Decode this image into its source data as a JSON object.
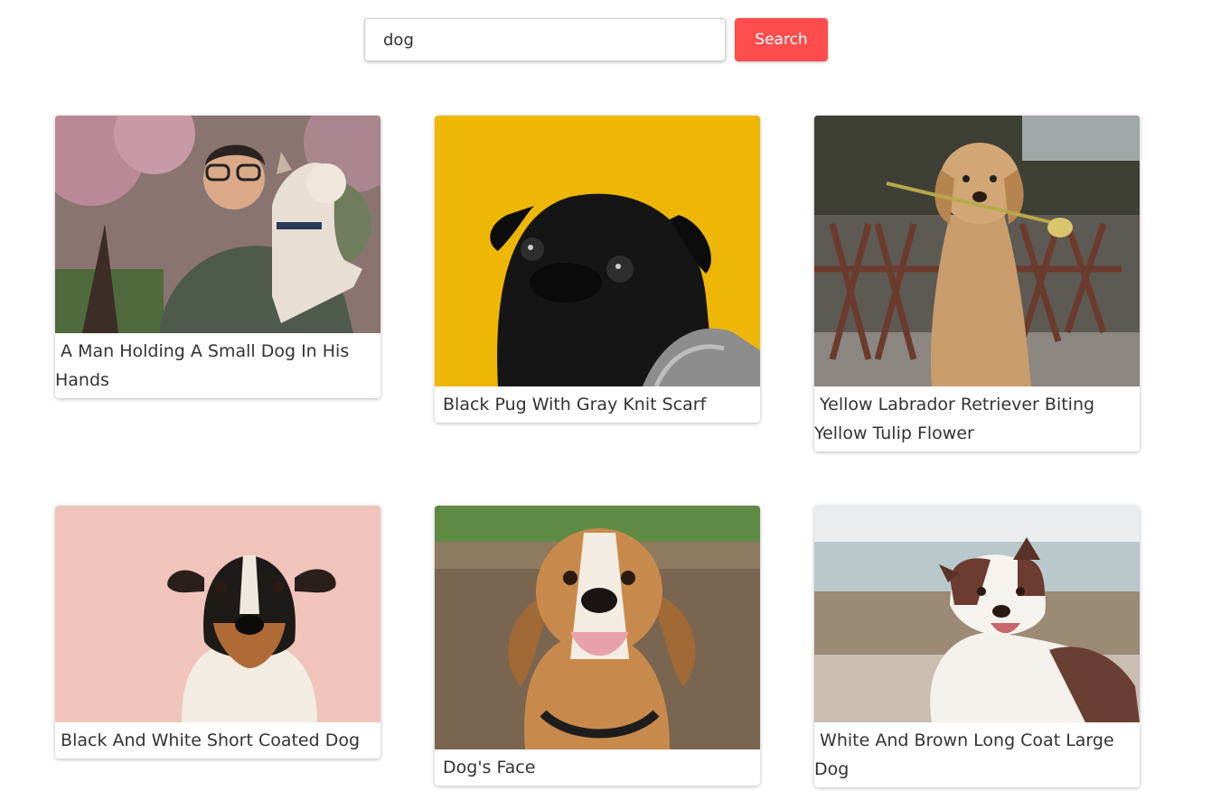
{
  "search": {
    "value": "dog",
    "placeholder": "",
    "button_label": "Search"
  },
  "accent_color": "#ff4d4d",
  "results": [
    {
      "caption": "A Man Holding A Small Dog In His Hands",
      "image": "man-holding-dog-photo"
    },
    {
      "caption": "Black Pug With Gray Knit Scarf",
      "image": "black-pug-photo"
    },
    {
      "caption": "Yellow Labrador Retriever Biting Yellow Tulip Flower",
      "image": "labrador-tulip-photo"
    },
    {
      "caption": "Black And White Short Coated Dog",
      "image": "terrier-photo"
    },
    {
      "caption": "Dog's Face",
      "image": "beagle-photo"
    },
    {
      "caption": "White And Brown Long Coat Large Dog",
      "image": "shepherd-photo"
    }
  ]
}
